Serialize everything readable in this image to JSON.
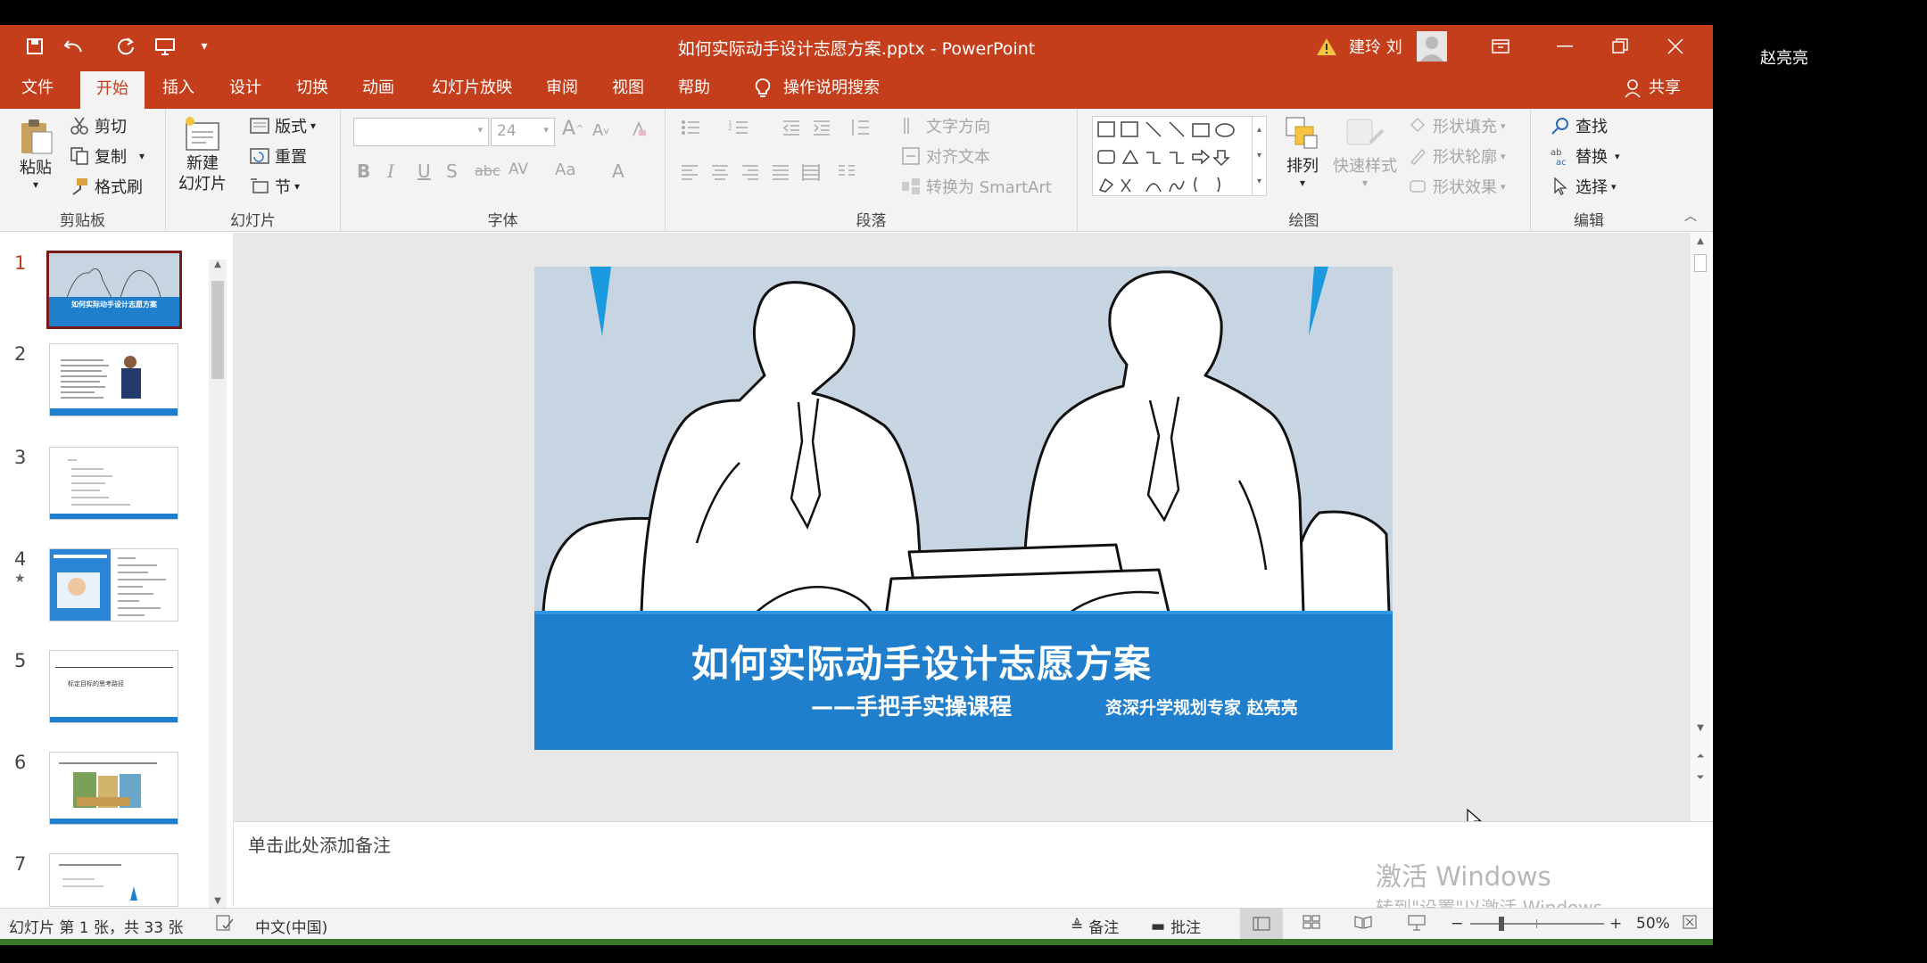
{
  "title_bar": {
    "doc_title": "如何实际动手设计志愿方案.pptx  -  PowerPoint",
    "user_name": "建玲 刘",
    "warning_icon": "warning-icon",
    "qa_icons": [
      "save-icon",
      "undo-icon",
      "redo-icon",
      "present-icon",
      "customize-icon"
    ]
  },
  "tabs": [
    "文件",
    "开始",
    "插入",
    "设计",
    "切换",
    "动画",
    "幻灯片放映",
    "审阅",
    "视图",
    "帮助",
    "操作说明搜索"
  ],
  "share_label": "共享",
  "ribbon": {
    "clipboard": {
      "paste": "粘贴",
      "cut": "剪切",
      "copy": "复制",
      "format_painter": "格式刷",
      "label": "剪贴板"
    },
    "slides": {
      "new_slide_1": "新建",
      "new_slide_2": "幻灯片",
      "layout": "版式",
      "reset": "重置",
      "section": "节",
      "label": "幻灯片"
    },
    "font": {
      "font_size": "24",
      "label": "字体",
      "bold": "B",
      "italic": "I",
      "underline": "U",
      "shadow": "S",
      "strike": "abc",
      "spacing": "AV",
      "case": "Aa",
      "color": "A"
    },
    "paragraph": {
      "text_direction": "文字方向",
      "align_text": "对齐文本",
      "smartart": "转换为 SmartArt",
      "label": "段落"
    },
    "drawing": {
      "arrange": "排列",
      "quick_styles": "快速样式",
      "fill": "形状填充",
      "outline": "形状轮廓",
      "effects": "形状效果",
      "label": "绘图"
    },
    "editing": {
      "find": "查找",
      "replace": "替换",
      "select": "选择",
      "label": "编辑"
    }
  },
  "thumbnails": [
    {
      "num": "1",
      "title": "如何实际动手设计志愿方案"
    },
    {
      "num": "2"
    },
    {
      "num": "3"
    },
    {
      "num": "4"
    },
    {
      "num": "5",
      "title": "标定目标的思考路径"
    },
    {
      "num": "6"
    },
    {
      "num": "7"
    }
  ],
  "slide": {
    "title": "如何实际动手设计志愿方案",
    "subtitle": "——手把手实操课程",
    "author": "资深升学规划专家    赵亮亮"
  },
  "notes_placeholder": "单击此处添加备注",
  "watermark": {
    "line1": "激活 Windows",
    "line2": "转到\"设置\"以激活 Windows。"
  },
  "status": {
    "slide_info": "幻灯片 第 1 张，共 33 张",
    "language": "中文(中国)",
    "notes": "备注",
    "comments": "批注",
    "zoom": "50%"
  },
  "outside_name": "赵亮亮",
  "colors": {
    "accent": "#c43e1c",
    "slide_band": "#1f7fcd",
    "slide_bg": "#c7d4e2"
  }
}
